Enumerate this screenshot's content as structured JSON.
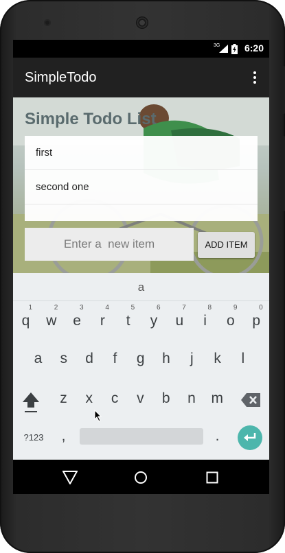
{
  "status_bar": {
    "time": "6:20",
    "network": "3G",
    "icons": [
      "signal-icon",
      "battery-icon"
    ]
  },
  "app_bar": {
    "title": "SimpleTodo",
    "menu_icon": "overflow-menu-icon"
  },
  "main": {
    "heading": "Simple Todo List",
    "items": [
      "first",
      "second one"
    ],
    "new_item_placeholder": "Enter a  new item",
    "add_button": "ADD ITEM"
  },
  "keyboard": {
    "suggestion": "a",
    "row1": [
      {
        "ch": "q",
        "hint": "1"
      },
      {
        "ch": "w",
        "hint": "2"
      },
      {
        "ch": "e",
        "hint": "3"
      },
      {
        "ch": "r",
        "hint": "4"
      },
      {
        "ch": "t",
        "hint": "5"
      },
      {
        "ch": "y",
        "hint": "6"
      },
      {
        "ch": "u",
        "hint": "7"
      },
      {
        "ch": "i",
        "hint": "8"
      },
      {
        "ch": "o",
        "hint": "9"
      },
      {
        "ch": "p",
        "hint": "0"
      }
    ],
    "row2": [
      "a",
      "s",
      "d",
      "f",
      "g",
      "h",
      "j",
      "k",
      "l"
    ],
    "row3": [
      "z",
      "x",
      "c",
      "v",
      "b",
      "n",
      "m"
    ],
    "symbols_key": "?123",
    "comma_key": ",",
    "period_key": ".",
    "special_icons": [
      "shift-icon",
      "backspace-icon",
      "enter-icon"
    ]
  },
  "nav_bar": {
    "icons": [
      "back-icon",
      "home-icon",
      "recents-icon"
    ]
  },
  "colors": {
    "app_bar": "#212121",
    "keyboard_bg": "#eceff1",
    "enter_key": "#4db6ac",
    "heading": "#5a6b6e"
  }
}
